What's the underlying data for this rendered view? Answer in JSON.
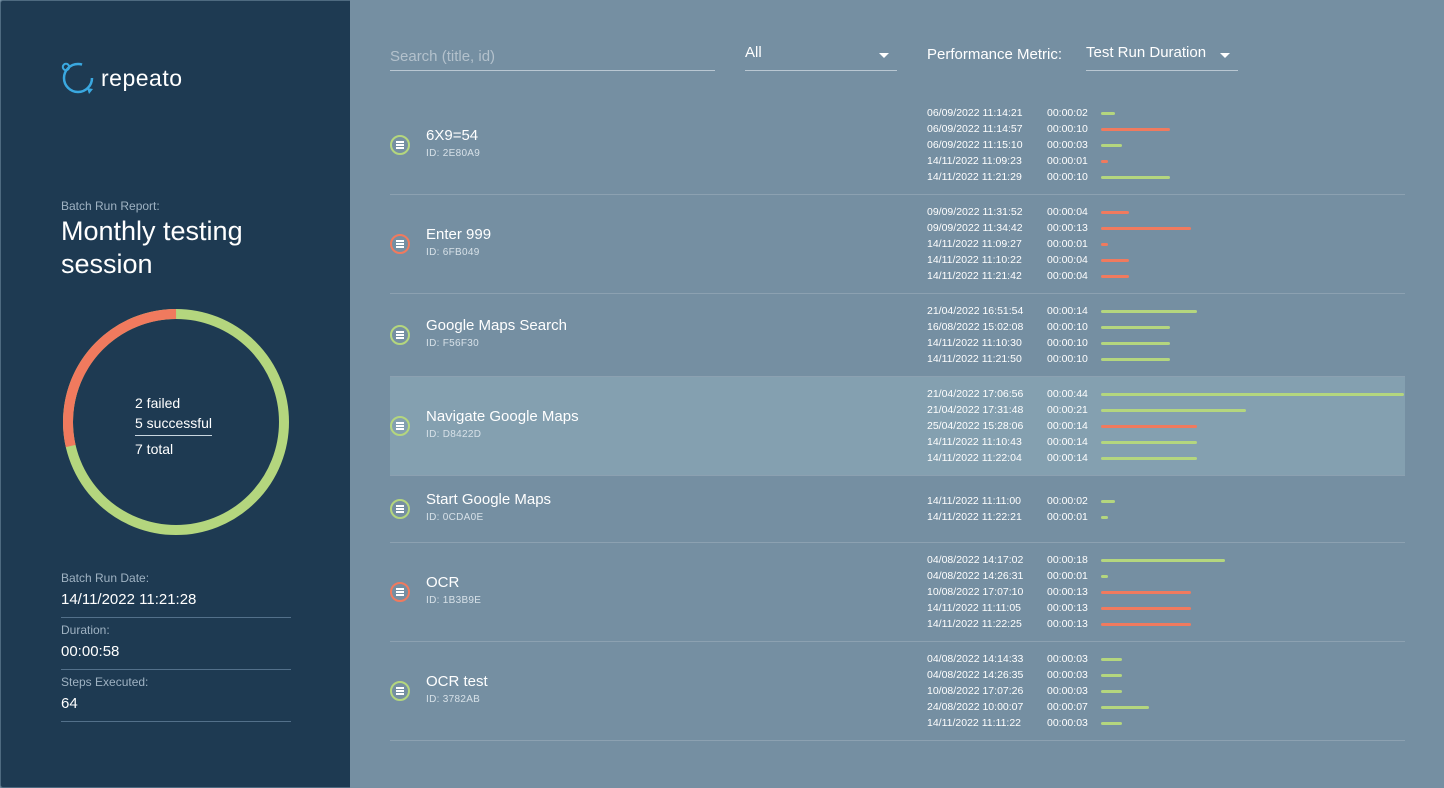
{
  "app": {
    "logo_text": "repeato"
  },
  "report": {
    "label": "Batch Run Report:",
    "title": "Monthly testing session",
    "failed_text": "2 failed",
    "successful_text": "5 successful",
    "total_text": "7 total",
    "failed_count": 2,
    "successful_count": 5,
    "batch_date_label": "Batch Run Date:",
    "batch_date": "14/11/2022 11:21:28",
    "duration_label": "Duration:",
    "duration": "00:00:58",
    "steps_label": "Steps Executed:",
    "steps": "64"
  },
  "filters": {
    "search_placeholder": "Search (title, id)",
    "status_value": "All",
    "metric_label": "Performance Metric:",
    "metric_value": "Test Run Duration"
  },
  "colors": {
    "success": "#b4d67e",
    "fail": "#f07a5e",
    "sidebar": "#1e3a52",
    "main": "#758fa2"
  },
  "max_duration_seconds": 44,
  "tests": [
    {
      "name": "6X9=54",
      "id": "ID: 2E80A9",
      "status": "ok",
      "icon": "list-icon",
      "runs": [
        {
          "date": "06/09/2022 11:14:21",
          "duration": "00:00:02",
          "seconds": 2,
          "status": "ok"
        },
        {
          "date": "06/09/2022 11:14:57",
          "duration": "00:00:10",
          "seconds": 10,
          "status": "fail"
        },
        {
          "date": "06/09/2022 11:15:10",
          "duration": "00:00:03",
          "seconds": 3,
          "status": "ok"
        },
        {
          "date": "14/11/2022 11:09:23",
          "duration": "00:00:01",
          "seconds": 1,
          "status": "fail"
        },
        {
          "date": "14/11/2022 11:21:29",
          "duration": "00:00:10",
          "seconds": 10,
          "status": "ok"
        }
      ]
    },
    {
      "name": "Enter 999",
      "id": "ID: 6FB049",
      "status": "fail",
      "icon": "list-icon",
      "runs": [
        {
          "date": "09/09/2022 11:31:52",
          "duration": "00:00:04",
          "seconds": 4,
          "status": "fail"
        },
        {
          "date": "09/09/2022 11:34:42",
          "duration": "00:00:13",
          "seconds": 13,
          "status": "fail"
        },
        {
          "date": "14/11/2022 11:09:27",
          "duration": "00:00:01",
          "seconds": 1,
          "status": "fail"
        },
        {
          "date": "14/11/2022 11:10:22",
          "duration": "00:00:04",
          "seconds": 4,
          "status": "fail"
        },
        {
          "date": "14/11/2022 11:21:42",
          "duration": "00:00:04",
          "seconds": 4,
          "status": "fail"
        }
      ]
    },
    {
      "name": "Google Maps Search",
      "id": "ID: F56F30",
      "status": "ok",
      "icon": "list-icon",
      "runs": [
        {
          "date": "21/04/2022 16:51:54",
          "duration": "00:00:14",
          "seconds": 14,
          "status": "ok"
        },
        {
          "date": "16/08/2022 15:02:08",
          "duration": "00:00:10",
          "seconds": 10,
          "status": "ok"
        },
        {
          "date": "14/11/2022 11:10:30",
          "duration": "00:00:10",
          "seconds": 10,
          "status": "ok"
        },
        {
          "date": "14/11/2022 11:21:50",
          "duration": "00:00:10",
          "seconds": 10,
          "status": "ok"
        }
      ]
    },
    {
      "name": "Navigate Google Maps",
      "id": "ID: D8422D",
      "status": "ok",
      "icon": "list-icon",
      "highlight": true,
      "runs": [
        {
          "date": "21/04/2022 17:06:56",
          "duration": "00:00:44",
          "seconds": 44,
          "status": "ok"
        },
        {
          "date": "21/04/2022 17:31:48",
          "duration": "00:00:21",
          "seconds": 21,
          "status": "ok"
        },
        {
          "date": "25/04/2022 15:28:06",
          "duration": "00:00:14",
          "seconds": 14,
          "status": "fail"
        },
        {
          "date": "14/11/2022 11:10:43",
          "duration": "00:00:14",
          "seconds": 14,
          "status": "ok"
        },
        {
          "date": "14/11/2022 11:22:04",
          "duration": "00:00:14",
          "seconds": 14,
          "status": "ok"
        }
      ]
    },
    {
      "name": "Start Google Maps",
      "id": "ID: 0CDA0E",
      "status": "ok",
      "icon": "list-icon",
      "runs": [
        {
          "date": "14/11/2022 11:11:00",
          "duration": "00:00:02",
          "seconds": 2,
          "status": "ok"
        },
        {
          "date": "14/11/2022 11:22:21",
          "duration": "00:00:01",
          "seconds": 1,
          "status": "ok"
        }
      ]
    },
    {
      "name": "OCR",
      "id": "ID: 1B3B9E",
      "status": "fail",
      "icon": "list-icon",
      "runs": [
        {
          "date": "04/08/2022 14:17:02",
          "duration": "00:00:18",
          "seconds": 18,
          "status": "ok"
        },
        {
          "date": "04/08/2022 14:26:31",
          "duration": "00:00:01",
          "seconds": 1,
          "status": "ok"
        },
        {
          "date": "10/08/2022 17:07:10",
          "duration": "00:00:13",
          "seconds": 13,
          "status": "fail"
        },
        {
          "date": "14/11/2022 11:11:05",
          "duration": "00:00:13",
          "seconds": 13,
          "status": "fail"
        },
        {
          "date": "14/11/2022 11:22:25",
          "duration": "00:00:13",
          "seconds": 13,
          "status": "fail"
        }
      ]
    },
    {
      "name": "OCR test",
      "id": "ID: 3782AB",
      "status": "ok",
      "icon": "list-icon",
      "runs": [
        {
          "date": "04/08/2022 14:14:33",
          "duration": "00:00:03",
          "seconds": 3,
          "status": "ok"
        },
        {
          "date": "04/08/2022 14:26:35",
          "duration": "00:00:03",
          "seconds": 3,
          "status": "ok"
        },
        {
          "date": "10/08/2022 17:07:26",
          "duration": "00:00:03",
          "seconds": 3,
          "status": "ok"
        },
        {
          "date": "24/08/2022 10:00:07",
          "duration": "00:00:07",
          "seconds": 7,
          "status": "ok"
        },
        {
          "date": "14/11/2022 11:11:22",
          "duration": "00:00:03",
          "seconds": 3,
          "status": "ok"
        }
      ]
    }
  ]
}
